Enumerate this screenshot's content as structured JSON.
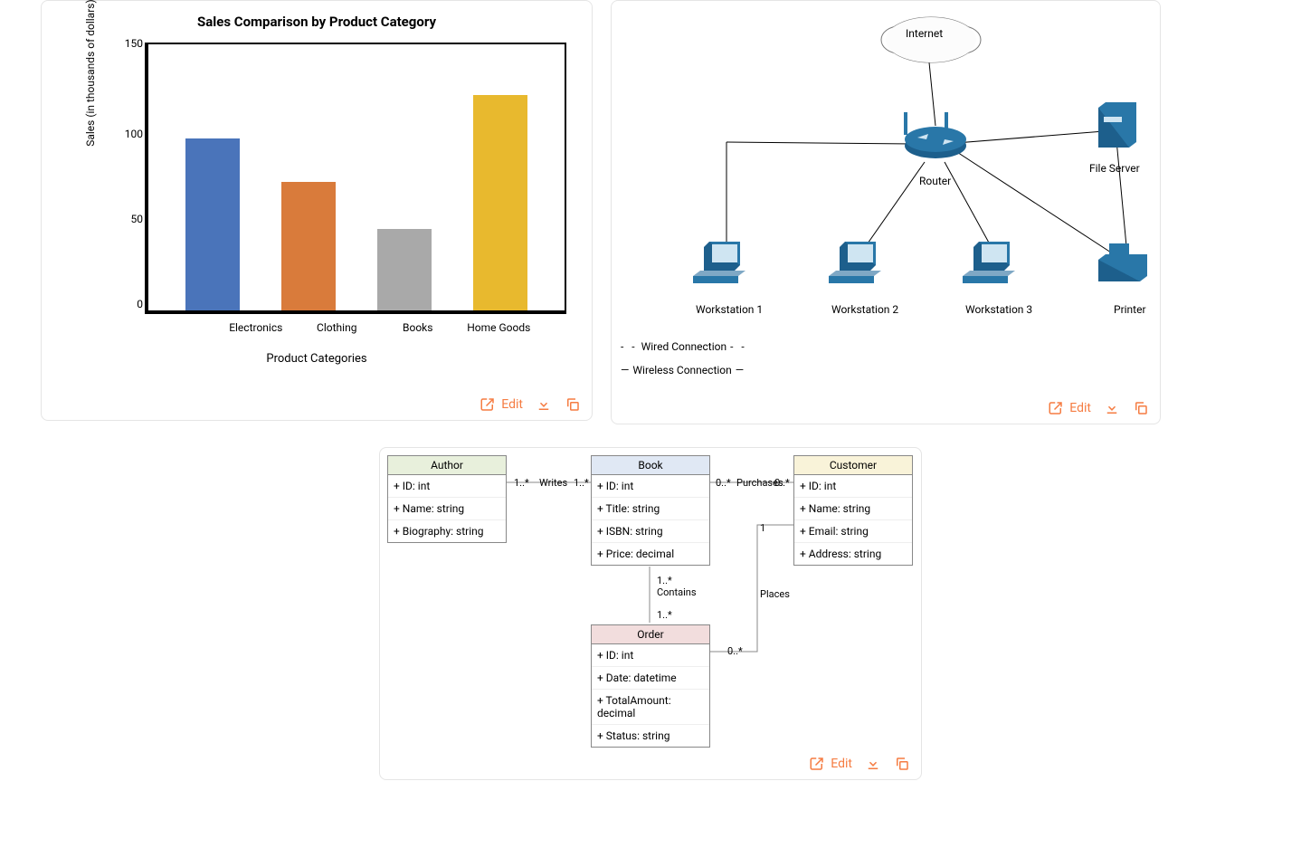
{
  "chart_data": {
    "type": "bar",
    "title": "Sales Comparison by Product Category",
    "xlabel": "Product Categories",
    "ylabel": "Sales (in thousands of dollars)",
    "categories": [
      "Electronics",
      "Clothing",
      "Books",
      "Home Goods"
    ],
    "values": [
      100,
      75,
      48,
      125
    ],
    "colors": [
      "#4a74ba",
      "#d97b3b",
      "#a9a9a9",
      "#e8b92e"
    ],
    "ylim": [
      0,
      150
    ],
    "yticks": [
      0,
      50,
      100,
      150
    ]
  },
  "network": {
    "nodes": {
      "internet": "Internet",
      "router": "Router",
      "file_server": "File Server",
      "ws1": "Workstation 1",
      "ws2": "Workstation 2",
      "ws3": "Workstation 3",
      "printer": "Printer"
    },
    "legend": {
      "wired": "Wired Connection",
      "wireless": "Wireless Connection"
    }
  },
  "uml": {
    "classes": {
      "author": {
        "name": "Author",
        "attrs": [
          "+ ID: int",
          "+ Name: string",
          "+ Biography: string"
        ],
        "fill": "#e8f0dc"
      },
      "book": {
        "name": "Book",
        "attrs": [
          "+ ID: int",
          "+ Title: string",
          "+ ISBN: string",
          "+ Price: decimal"
        ],
        "fill": "#e0e8f4"
      },
      "customer": {
        "name": "Customer",
        "attrs": [
          "+ ID: int",
          "+ Name: string",
          "+ Email: string",
          "+ Address: string"
        ],
        "fill": "#f9f3d9"
      },
      "order": {
        "name": "Order",
        "attrs": [
          "+ ID: int",
          "+ Date: datetime",
          "+ TotalAmount: decimal",
          "+ Status: string"
        ],
        "fill": "#f2dddd"
      }
    },
    "relations": {
      "writes": {
        "label": "Writes",
        "m1": "1..*",
        "m2": "1..*"
      },
      "purchases": {
        "label": "Purchases",
        "m1": "0..*",
        "m2": "0..*"
      },
      "contains": {
        "label": "Contains",
        "m1": "1..*",
        "m2": "1..*"
      },
      "places": {
        "label": "Places",
        "m1": "1",
        "m2": "0..*"
      }
    }
  },
  "toolbar": {
    "edit": "Edit"
  }
}
